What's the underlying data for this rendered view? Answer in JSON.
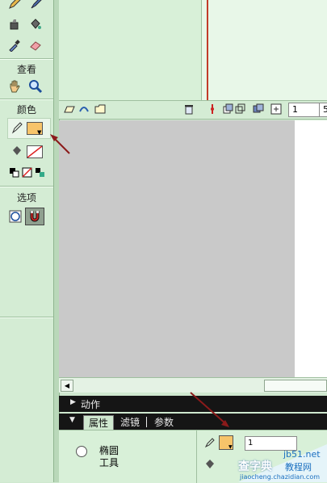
{
  "toolbar": {
    "sections": [
      {
        "title": "查看"
      },
      {
        "title": "颜色"
      },
      {
        "title": "选项"
      }
    ],
    "tools_top": [
      "pencil-icon",
      "brush-icon",
      "ink-bottle-icon",
      "paint-bucket-icon",
      "eyedropper-icon",
      "eraser-icon"
    ],
    "view_tools": [
      "hand-icon",
      "zoom-icon"
    ],
    "stroke_color": "#333333",
    "fill_color": "#f7c46a"
  },
  "timeline": {
    "frame_number": "1",
    "fps_partial": "5"
  },
  "panels": {
    "actions_label": "动作",
    "tabs": [
      "属性",
      "滤镜",
      "参数"
    ]
  },
  "properties": {
    "tool_name_line1": "椭圆",
    "tool_name_line2": "工具",
    "fill_color": "#f7c46a",
    "stroke_size_partial": "1"
  },
  "watermark": {
    "site": "jb51.net",
    "line1": "查字典",
    "line2": "教程网",
    "url": "jiaocheng.chazidian.com"
  }
}
